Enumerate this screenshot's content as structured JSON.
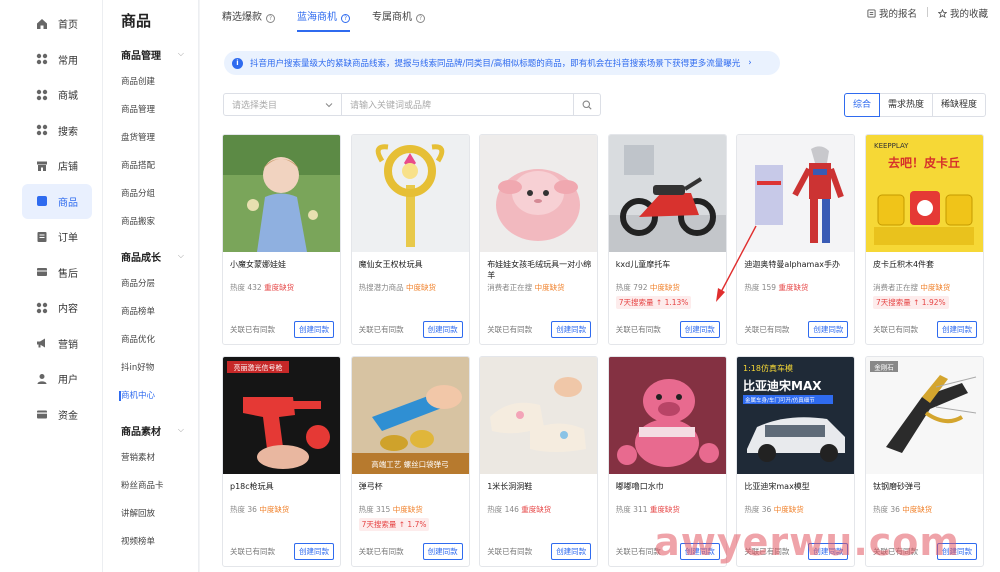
{
  "nav": [
    {
      "label": "首页",
      "icon": "home-icon"
    },
    {
      "label": "常用",
      "icon": "grid-icon"
    },
    {
      "label": "商城",
      "icon": "grid-icon"
    },
    {
      "label": "搜索",
      "icon": "grid-icon"
    },
    {
      "label": "店铺",
      "icon": "store-icon"
    },
    {
      "label": "商品",
      "icon": "product-icon",
      "active": true
    },
    {
      "label": "订单",
      "icon": "order-icon"
    },
    {
      "label": "售后",
      "icon": "aftersale-icon"
    },
    {
      "label": "内容",
      "icon": "grid-icon"
    },
    {
      "label": "营销",
      "icon": "megaphone-icon"
    },
    {
      "label": "用户",
      "icon": "user-icon"
    },
    {
      "label": "资金",
      "icon": "wallet-icon"
    }
  ],
  "subnav": {
    "title": "商品",
    "groups": [
      {
        "label": "商品管理",
        "items": [
          "商品创建",
          "商品管理",
          "盘货管理",
          "商品搭配",
          "商品分组",
          "商品搬家"
        ]
      },
      {
        "label": "商品成长",
        "items": [
          "商品分层",
          "商品榜单",
          "商品优化",
          "抖in好物",
          "商机中心"
        ]
      },
      {
        "label": "商品素材",
        "items": [
          "营销素材",
          "粉丝商品卡",
          "讲解回放",
          "视频榜单"
        ]
      }
    ],
    "active_item": "商机中心"
  },
  "tabs": [
    "精选爆款",
    "蓝海商机",
    "专属商机"
  ],
  "active_tab": "蓝海商机",
  "topright": {
    "report": "我的报名",
    "favorites": "我的收藏"
  },
  "notice": "抖音用户搜索量级大的紧缺商品线索，提报与线索同品牌/同类目/高相似标题的商品，即有机会在抖音搜索场景下获得更多流量曝光",
  "filter": {
    "category_placeholder": "请选择类目",
    "keyword_placeholder": "请输入关键词或品牌"
  },
  "sort": [
    "综合",
    "需求热度",
    "稀缺程度"
  ],
  "active_sort": "综合",
  "cards": [
    {
      "title": "小魔女蒙娜娃娃",
      "heat_label": "热度",
      "heat": "432",
      "status": "重度缺货",
      "status_class": "hot",
      "trend": "",
      "footer": "关联已有同款",
      "button": "创建同款"
    },
    {
      "title": "魔仙女王权杖玩具",
      "heat_label": "热搜潜力商品",
      "heat": "",
      "status": "中度缺货",
      "status_class": "warn",
      "trend": "",
      "footer": "关联已有同款",
      "button": "创建同款"
    },
    {
      "title": "布娃娃女孩毛绒玩具一对小绵羊",
      "heat_label": "消费者正在搜",
      "heat": "",
      "status": "中度缺货",
      "status_class": "warn",
      "trend": "",
      "footer": "关联已有同款",
      "button": "创建同款"
    },
    {
      "title": "kxd儿童摩托车",
      "heat_label": "热度",
      "heat": "792",
      "status": "中度缺货",
      "status_class": "warn",
      "trend": "7天搜索量 ↑ 1.13%",
      "footer": "关联已有同款",
      "button": "创建同款"
    },
    {
      "title": "迪迦奥特曼alphamax手办",
      "heat_label": "热度",
      "heat": "159",
      "status": "重度缺货",
      "status_class": "hot",
      "trend": "",
      "footer": "关联已有同款",
      "button": "创建同款"
    },
    {
      "title": "皮卡丘积木4件套",
      "heat_label": "消费者正在搜",
      "heat": "",
      "status": "中度缺货",
      "status_class": "warn",
      "trend": "7天搜索量 ↑ 1.92%",
      "footer": "关联已有同款",
      "button": "创建同款"
    },
    {
      "title": "p18c枪玩具",
      "heat_label": "热度",
      "heat": "36",
      "status": "中度缺货",
      "status_class": "warn",
      "trend": "",
      "footer": "关联已有同款",
      "button": "创建同款"
    },
    {
      "title": "弹弓杯",
      "heat_label": "热度",
      "heat": "315",
      "status": "中度缺货",
      "status_class": "warn",
      "trend": "7天搜索量 ↑ 1.7%",
      "footer": "关联已有同款",
      "button": "创建同款"
    },
    {
      "title": "1米长洞洞鞋",
      "heat_label": "热度",
      "heat": "146",
      "status": "重度缺货",
      "status_class": "hot",
      "trend": "",
      "footer": "关联已有同款",
      "button": "创建同款"
    },
    {
      "title": "嘟嘟噜口水巾",
      "heat_label": "热度",
      "heat": "311",
      "status": "重度缺货",
      "status_class": "hot",
      "trend": "",
      "footer": "关联已有同款",
      "button": "创建同款"
    },
    {
      "title": "比亚迪宋max模型",
      "heat_label": "热度",
      "heat": "36",
      "status": "中度缺货",
      "status_class": "warn",
      "trend": "",
      "footer": "关联已有同款",
      "button": "创建同款"
    },
    {
      "title": "钛钢磨砂弹弓",
      "heat_label": "热度",
      "heat": "36",
      "status": "中度缺货",
      "status_class": "warn",
      "trend": "",
      "footer": "关联已有同款",
      "button": "创建同款"
    }
  ],
  "image_overlays": {
    "gun": "亮丽激光信号枪",
    "cup": "高端工艺 螺丝口袋弹弓",
    "car_top": "1:18仿真车模",
    "car_name": "比亚迪宋MAX",
    "car_sub": "金属车身/车门可开/仿真细节",
    "slingshot_tag": "金刚石",
    "pikachu_brand": "KEEPPLAY",
    "pikachu_title": "去吧！皮卡丘"
  },
  "watermark": "awyerwu.com",
  "colors": {
    "accent": "#2f6bef",
    "hot": "#e64545",
    "warn": "#f0802a"
  }
}
